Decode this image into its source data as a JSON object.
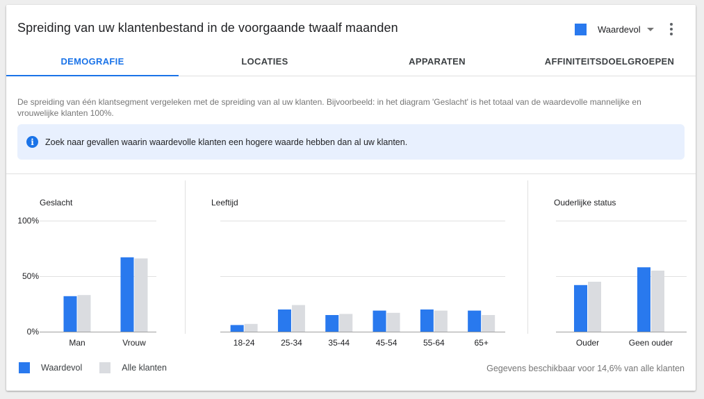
{
  "header": {
    "title": "Spreiding van uw klantenbestand in de voorgaande twaalf maanden",
    "segment_select": {
      "label": "Waardevol",
      "color": "#2979ee"
    }
  },
  "tabs": [
    {
      "label": "DEMOGRAFIE",
      "active": true
    },
    {
      "label": "LOCATIES",
      "active": false
    },
    {
      "label": "APPARATEN",
      "active": false
    },
    {
      "label": "AFFINITEITSDOELGROEPEN",
      "active": false
    }
  ],
  "description": "De spreiding van één klantsegment vergeleken met de spreiding van al uw klanten. Bijvoorbeeld: in het diagram 'Geslacht' is het totaal van de waardevolle mannelijke en vrouwelijke klanten 100%.",
  "info": {
    "icon": "info-icon",
    "text": "Zoek naar gevallen waarin waardevolle klanten een hogere waarde hebben dan al uw klanten."
  },
  "colors": {
    "valuable": "#2979ee",
    "all": "#dadce0"
  },
  "chart_data": [
    {
      "type": "bar",
      "title": "Geslacht",
      "categories": [
        "Man",
        "Vrouw"
      ],
      "series": [
        {
          "name": "Waardevol",
          "values": [
            32,
            67
          ]
        },
        {
          "name": "Alle klanten",
          "values": [
            33,
            66
          ]
        }
      ],
      "yticks": [
        "100%",
        "50%",
        "0%"
      ],
      "ylim": [
        0,
        100
      ],
      "grid": true
    },
    {
      "type": "bar",
      "title": "Leeftijd",
      "categories": [
        "18-24",
        "25-34",
        "35-44",
        "45-54",
        "55-64",
        "65+"
      ],
      "series": [
        {
          "name": "Waardevol",
          "values": [
            6,
            20,
            15,
            19,
            20,
            19
          ]
        },
        {
          "name": "Alle klanten",
          "values": [
            7,
            24,
            16,
            17,
            19,
            15
          ]
        }
      ],
      "ylim": [
        0,
        100
      ],
      "grid": true
    },
    {
      "type": "bar",
      "title": "Ouderlijke status",
      "categories": [
        "Ouder",
        "Geen ouder"
      ],
      "series": [
        {
          "name": "Waardevol",
          "values": [
            42,
            58
          ]
        },
        {
          "name": "Alle klanten",
          "values": [
            45,
            55
          ]
        }
      ],
      "ylim": [
        0,
        100
      ],
      "grid": true
    }
  ],
  "legend": [
    {
      "label": "Waardevol",
      "color": "#2979ee"
    },
    {
      "label": "Alle klanten",
      "color": "#dadce0"
    }
  ],
  "footnote": "Gegevens beschikbaar voor 14,6% van alle klanten"
}
